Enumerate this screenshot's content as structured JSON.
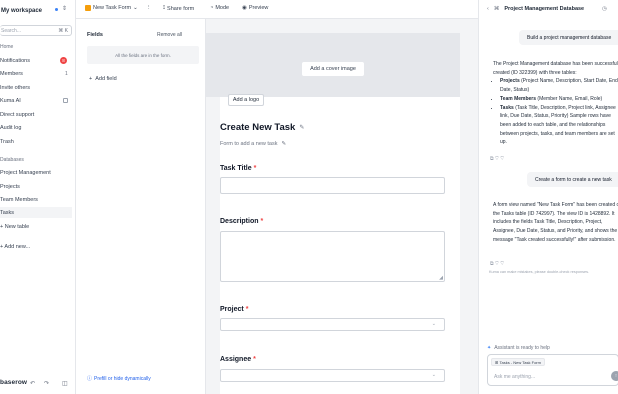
{
  "workspace": {
    "name": "My workspace"
  },
  "sidebar": {
    "search_placeholder": "Search...",
    "search_shortcut": "⌘ K",
    "section_home": "Home",
    "items": [
      {
        "label": "Notifications",
        "badge": "8"
      },
      {
        "label": "Members",
        "count": "1"
      },
      {
        "label": "Invite others"
      },
      {
        "label": "Kuma AI"
      },
      {
        "label": "Direct support"
      },
      {
        "label": "Audit log"
      },
      {
        "label": "Trash"
      }
    ],
    "section_databases": "Databases",
    "database": "Project Management",
    "tables": [
      {
        "label": "Projects"
      },
      {
        "label": "Team Members"
      },
      {
        "label": "Tasks"
      }
    ],
    "new_table": "+ New table",
    "add_new": "+ Add new...",
    "logo": "baserow"
  },
  "topbar": {
    "form_name": "New Task Form",
    "share": "Share form",
    "mode": "Mode",
    "preview": "Preview"
  },
  "fields_panel": {
    "title": "Fields",
    "remove_all": "Remove all",
    "all_in_form": "All the fields are in the form.",
    "add_field": "Add field",
    "prefill": "Prefill or hide dynamically"
  },
  "form": {
    "cover_button": "Add a cover image",
    "logo_button": "Add a logo",
    "title": "Create New Task",
    "description": "Form to add a new task",
    "fields": [
      {
        "label": "Task Title",
        "required": "*"
      },
      {
        "label": "Description",
        "required": "*"
      },
      {
        "label": "Project",
        "required": "*"
      },
      {
        "label": "Assignee",
        "required": "*"
      }
    ]
  },
  "assistant": {
    "title": "Project Management Database",
    "user_msg_1": "Build a project management database",
    "reply_1_intro": "The Project Management database has been successfully created (ID 322399) with three tables:",
    "reply_1_items": [
      {
        "name": "Projects",
        "text": " (Project Name, Description, Start Date, End Date, Status)"
      },
      {
        "name": "Team Members",
        "text": " (Member Name, Email, Role)"
      },
      {
        "name": "Tasks",
        "text": " (Task Title, Description, Project link, Assignee link, Due Date, Status, Priority) Sample rows have been added to each table, and the relationships between projects, tasks, and team members are set up."
      }
    ],
    "user_msg_2": "Create a form to create a new task",
    "reply_2": "A form view named \"New Task Form\" has been created on the Tasks table (ID 742997). The view ID is 1428892. It includes the fields Task Title, Description, Project, Assignee, Due Date, Status, and Priority, and shows the message \"Task created successfully!\" after submission.",
    "reactions": "⧉  ♡  ♡",
    "disclaimer": "Kuma can make mistakes, please double-check responses.",
    "status": "Assistant is ready to help",
    "context_chip": "Tasks - New Task Form",
    "input_placeholder": "Ask me anything..."
  },
  "colors": {
    "accent": "#3b82f6",
    "required": "#ef4444",
    "badge": "#ef4444"
  }
}
